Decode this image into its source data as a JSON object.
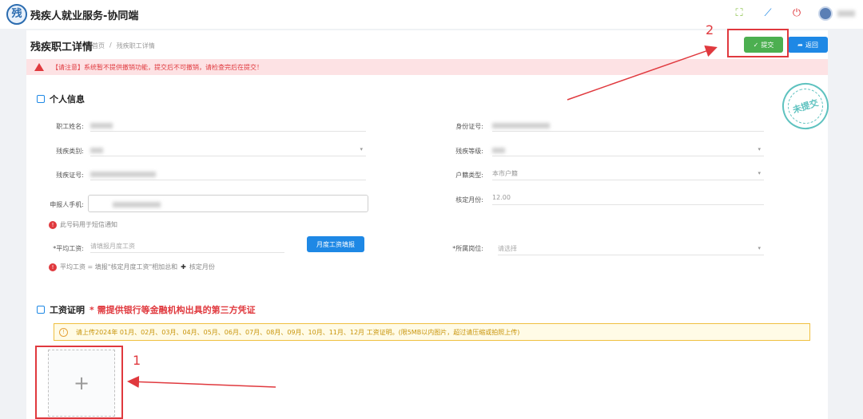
{
  "app": {
    "logo_text": "残",
    "title": "残疾人就业服务-协同端"
  },
  "topbar": {
    "icons": [
      "fullscreen-icon",
      "clear-icon",
      "power-icon"
    ]
  },
  "page": {
    "title": "残疾职工详情",
    "breadcrumb": [
      "首页",
      "/",
      "残疾职工详情"
    ],
    "submit_label": "提交",
    "back_label": "返回"
  },
  "warning": {
    "text": "【请注意】系统暂不提供撤销功能，提交后不可撤销，请检查完后在提交！"
  },
  "stamp": {
    "text": "未提交"
  },
  "personal": {
    "title": "个人信息",
    "name_label": "职工姓名:",
    "id_label": "身份证号:",
    "disability_type_label": "残疾类别:",
    "disability_level_label": "残疾等级:",
    "disability_cert_label": "残疾证号:",
    "household_label": "户籍类型:",
    "household_value": "本市户籍",
    "phone_label": "申报人手机:",
    "months_label": "核定月份:",
    "months_value": "12.00",
    "phone_hint": "此号码用于短信通知",
    "salary_label": "*平均工资:",
    "salary_placeholder": "请填报月度工资",
    "month_salary_button": "月度工资填报",
    "position_label": "*所属岗位:",
    "position_placeholder": "请选择",
    "salary_hint_1": "平均工资 = 填报\"核定月度工资\"相加总和",
    "salary_hint_2": "核定月份"
  },
  "salary_proof": {
    "title": "工资证明",
    "required_note": "* 需提供银行等金融机构出具的第三方凭证",
    "notice": "请上传2024年 01月、02月、03月、04月、05月、06月、07月、08月、09月、10月、11月、12月 工资证明。(限5MB以内图片，超过请压缩或拍照上传)",
    "upload_symbol": "+"
  },
  "annotations": {
    "marker_1": "1",
    "marker_2": "2"
  },
  "colors": {
    "primary": "#1e88e5",
    "success": "#4caf50",
    "danger": "#e0393e",
    "warning": "#e6a23c",
    "stamp": "#36b3b0"
  }
}
